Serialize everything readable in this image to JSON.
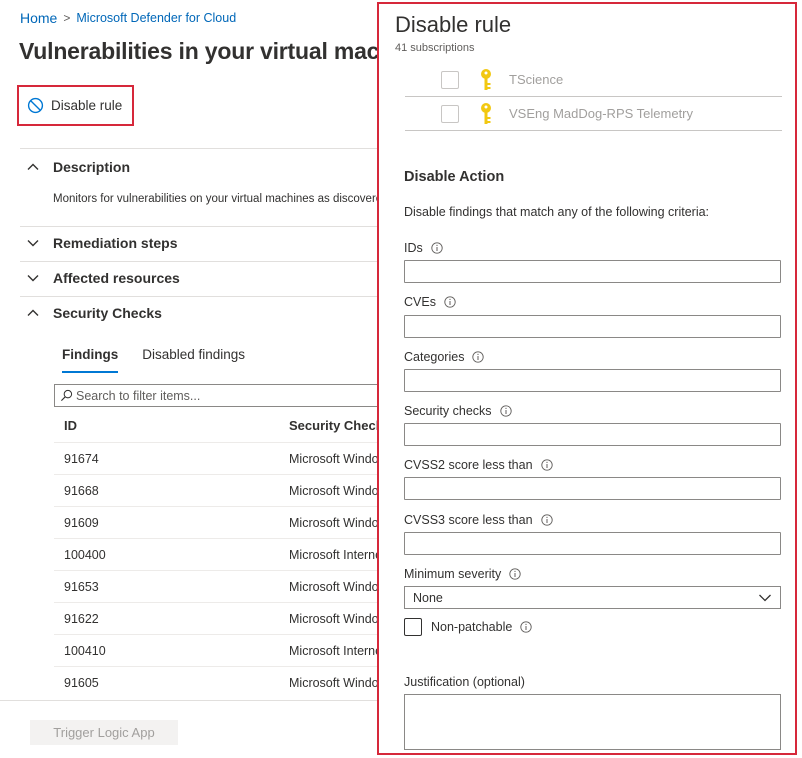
{
  "breadcrumb": {
    "home": "Home",
    "current": "Microsoft Defender for Cloud"
  },
  "page": {
    "title": "Vulnerabilities in your virtual machines should be remediated",
    "disable_rule_label": "Disable rule",
    "sections": {
      "description": "Description",
      "description_text": "Monitors for vulnerabilities on your virtual machines as discovered",
      "remediation": "Remediation steps",
      "affected": "Affected resources",
      "security_checks": "Security Checks"
    },
    "tabs": [
      "Findings",
      "Disabled findings"
    ],
    "search_placeholder": "Search to filter items...",
    "columns": [
      "ID",
      "Security Check"
    ],
    "rows": [
      {
        "id": "91674",
        "check": "Microsoft Windows"
      },
      {
        "id": "91668",
        "check": "Microsoft Windows"
      },
      {
        "id": "91609",
        "check": "Microsoft Windows"
      },
      {
        "id": "100400",
        "check": "Microsoft Internet"
      },
      {
        "id": "91653",
        "check": "Microsoft Windows"
      },
      {
        "id": "91622",
        "check": "Microsoft Windows"
      },
      {
        "id": "100410",
        "check": "Microsoft Internet"
      },
      {
        "id": "91605",
        "check": "Microsoft Windows"
      }
    ],
    "trigger_label": "Trigger Logic App"
  },
  "panel": {
    "title": "Disable rule",
    "subtitle": "41 subscriptions",
    "subscriptions": [
      {
        "name": "TScience",
        "icon": "key-icon"
      },
      {
        "name": "VSEng MadDog-RPS Telemetry",
        "icon": "key-icon"
      }
    ],
    "action_heading": "Disable Action",
    "action_desc": "Disable findings that match any of the following criteria:",
    "fields": {
      "ids": "IDs",
      "cves": "CVEs",
      "categories": "Categories",
      "security_checks": "Security checks",
      "cvss2": "CVSS2 score less than",
      "cvss3": "CVSS3 score less than"
    },
    "min_severity_label": "Minimum severity",
    "min_severity_value": "None",
    "non_patchable_label": "Non-patchable",
    "justification_label": "Justification (optional)"
  },
  "colors": {
    "accent": "#0078d4",
    "highlight": "#d6283a",
    "key": "#f2c811"
  }
}
